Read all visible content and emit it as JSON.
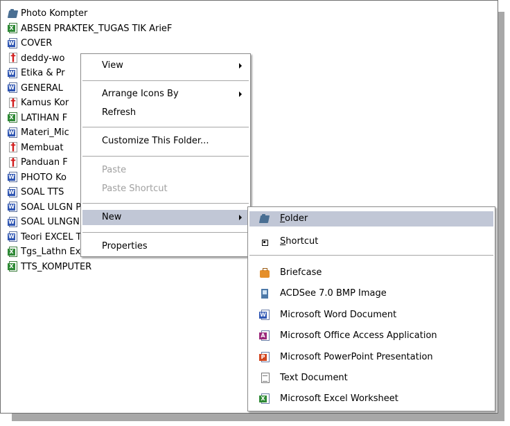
{
  "files": [
    {
      "name": "Photo Kompter",
      "icon": "folder-icon"
    },
    {
      "name": "ABSEN PRAKTEK_TUGAS TIK ArieF",
      "icon": "excel-file-icon"
    },
    {
      "name": "COVER",
      "icon": "word-file-icon"
    },
    {
      "name": "deddy-wo",
      "icon": "pdf-file-icon"
    },
    {
      "name": "Etika & Pr",
      "icon": "word-file-icon"
    },
    {
      "name": "GENERAL",
      "icon": "word-file-icon"
    },
    {
      "name": "Kamus Kor",
      "icon": "pdf-file-icon"
    },
    {
      "name": "LATIHAN F",
      "icon": "excel-file-icon"
    },
    {
      "name": "Materi_Mic",
      "icon": "word-file-icon"
    },
    {
      "name": "Membuat",
      "icon": "pdf-file-icon"
    },
    {
      "name": "Panduan F",
      "icon": "pdf-file-icon"
    },
    {
      "name": "PHOTO Ko",
      "icon": "word-file-icon"
    },
    {
      "name": "SOAL TTS",
      "icon": "word-file-icon"
    },
    {
      "name": "SOAL ULGN PRKTEK EXCEL",
      "icon": "word-file-icon"
    },
    {
      "name": "SOAL ULNGN EXCEL new",
      "icon": "word-file-icon"
    },
    {
      "name": "Teori EXCEL Tambahan",
      "icon": "word-file-icon"
    },
    {
      "name": "Tgs_Lathn Excel",
      "icon": "excel-file-icon"
    },
    {
      "name": "TTS_KOMPUTER",
      "icon": "excel-file-icon"
    }
  ],
  "context_menu": {
    "view": "View",
    "arrange_icons_by": "Arrange Icons By",
    "refresh": "Refresh",
    "customize_folder": "Customize This Folder...",
    "paste": "Paste",
    "paste_shortcut": "Paste Shortcut",
    "new": "New",
    "properties": "Properties"
  },
  "new_submenu": {
    "folder_key": "F",
    "folder_rest": "older",
    "shortcut_key": "S",
    "shortcut_rest": "hortcut",
    "briefcase": "Briefcase",
    "acdsee_bmp": "ACDSee 7.0 BMP Image",
    "word_doc": "Microsoft Word Document",
    "access_app": "Microsoft Office Access Application",
    "ppt": "Microsoft PowerPoint Presentation",
    "text_doc": "Text Document",
    "excel": "Microsoft Excel Worksheet"
  },
  "colors": {
    "highlight": "#c1c7d6",
    "disabled_text": "#a0a0a0"
  }
}
